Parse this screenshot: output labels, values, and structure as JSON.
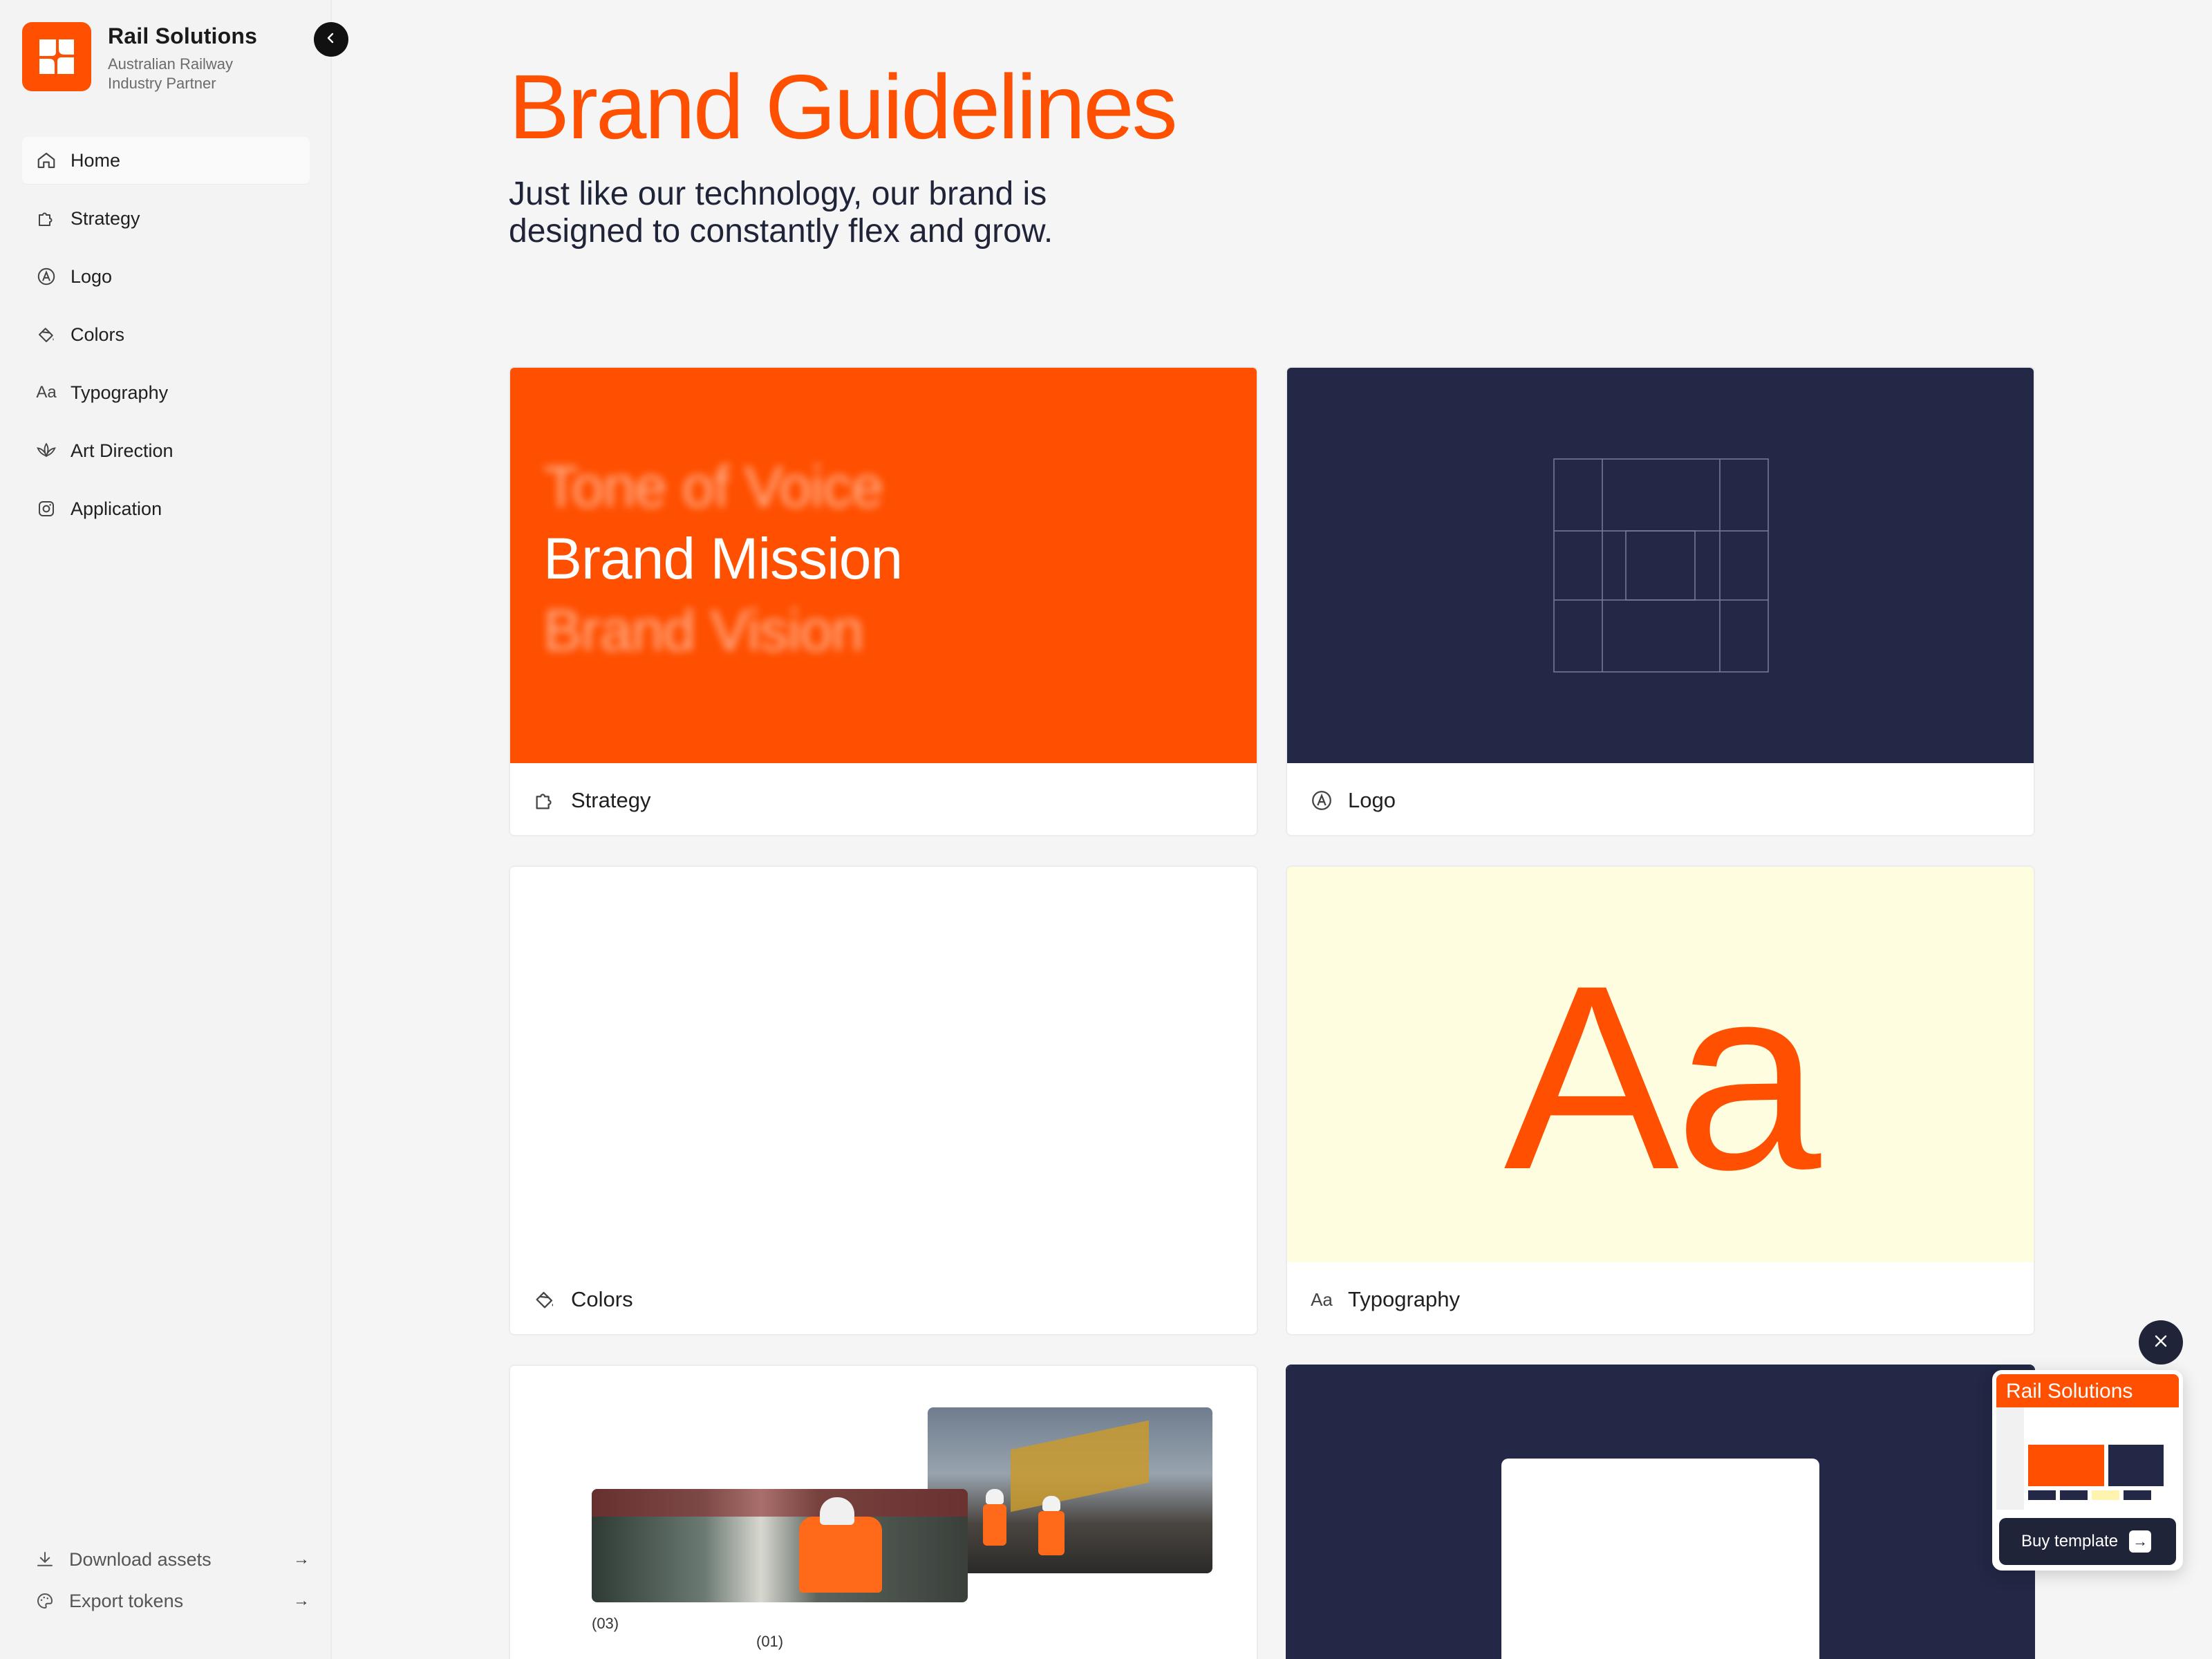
{
  "brand": {
    "name": "Rail Solutions",
    "subtitle": "Australian Railway Industry Partner"
  },
  "sidebar": {
    "items": [
      {
        "label": "Home",
        "icon": "home-icon",
        "active": true
      },
      {
        "label": "Strategy",
        "icon": "puzzle-icon"
      },
      {
        "label": "Logo",
        "icon": "logo-a-icon"
      },
      {
        "label": "Colors",
        "icon": "paint-bucket-icon"
      },
      {
        "label": "Typography",
        "icon": "typography-icon"
      },
      {
        "label": "Art Direction",
        "icon": "lotus-icon"
      },
      {
        "label": "Application",
        "icon": "instagram-icon"
      }
    ],
    "bottom": [
      {
        "label": "Download assets",
        "icon": "download-icon"
      },
      {
        "label": "Export tokens",
        "icon": "palette-icon"
      }
    ]
  },
  "main": {
    "title": "Brand Guidelines",
    "subtitle": "Just like our technology, our brand is designed to constantly flex and grow."
  },
  "cards": {
    "strategy": {
      "label": "Strategy",
      "lines": [
        "Tone of Voice",
        "Brand Mission",
        "Brand Vision"
      ]
    },
    "logo": {
      "label": "Logo"
    },
    "colors": {
      "label": "Colors"
    },
    "typography": {
      "label": "Typography",
      "sample": "Aa"
    },
    "art": {
      "captions": [
        "(03)",
        "(01)"
      ]
    },
    "app": {}
  },
  "promo": {
    "thumb_title": "Rail Solutions",
    "button_label": "Buy template"
  },
  "colors": {
    "accent": "#ff4f00",
    "navy": "#222845",
    "cream": "#fffde0"
  }
}
